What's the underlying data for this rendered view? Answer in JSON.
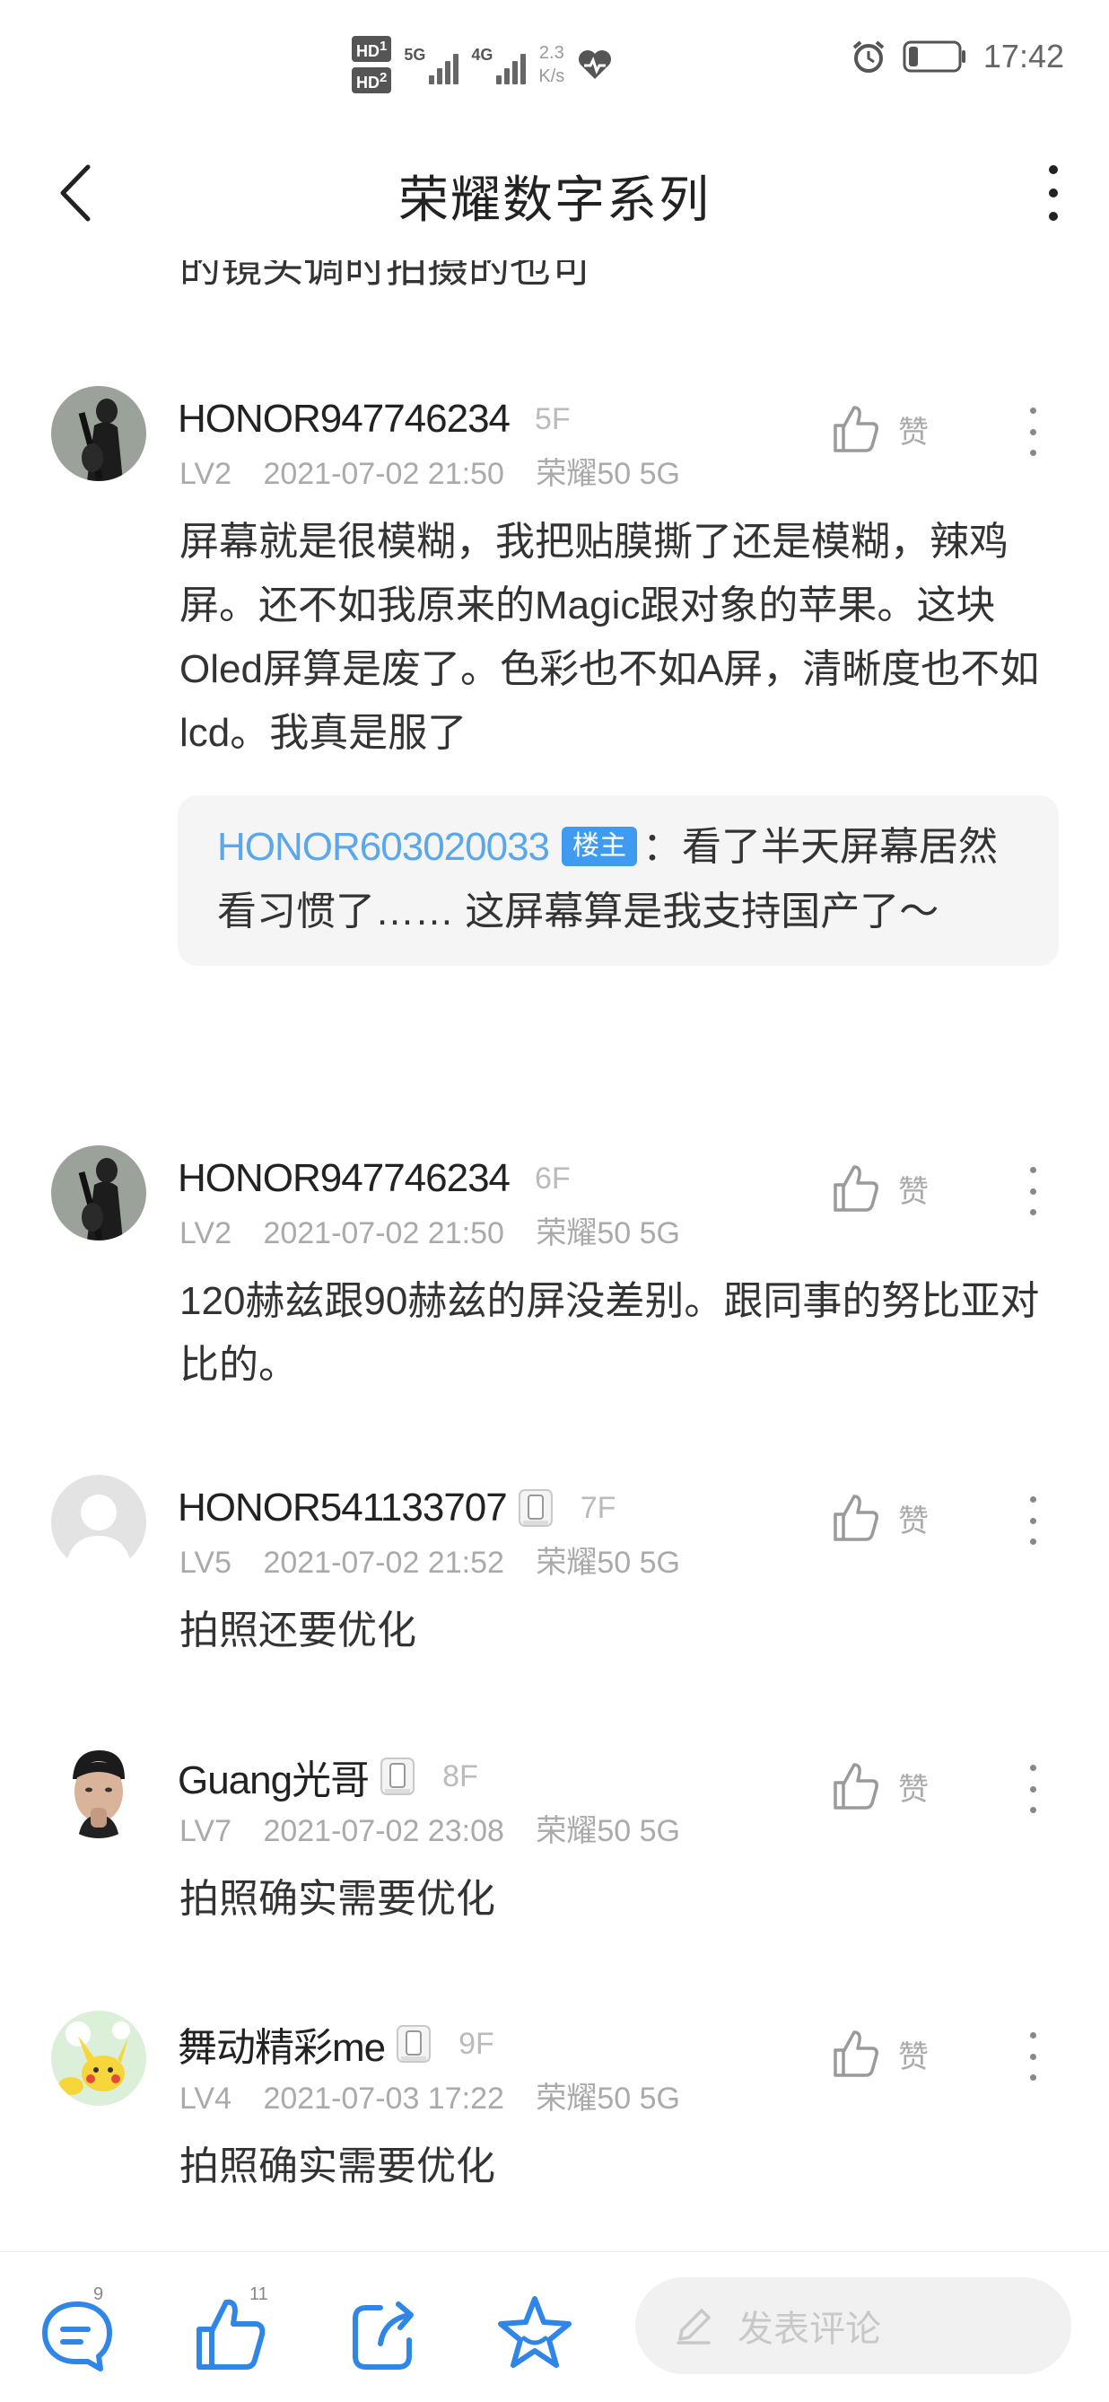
{
  "status_bar": {
    "hd1": "HD",
    "hd1_index": "1",
    "hd2": "HD",
    "hd2_index": "2",
    "net1": "5G",
    "net2": "4G",
    "speed_value": "2.3",
    "speed_unit": "K/s",
    "battery_level": 0.2,
    "time": "17:42"
  },
  "header": {
    "title": "荣耀数字系列"
  },
  "scroll_fragment": "的镜头调时拍摄的也可",
  "comments": [
    {
      "username": "HONOR947746234",
      "floor": "5F",
      "level": "LV2",
      "datetime": "2021-07-02 21:50",
      "device": "荣耀50 5G",
      "like_label": "赞",
      "text": "屏幕就是很模糊，我把贴膜撕了还是模糊，辣鸡屏。还不如我原来的Magic跟对象的苹果。这块Oled屏算是废了。色彩也不如A屏，清晰度也不如lcd。我真是服了",
      "reply": {
        "user": "HONOR603020033",
        "tag": "楼主",
        "text": "：看了半天屏幕居然看习惯了……  这屏幕算是我支持国产了～"
      }
    },
    {
      "username": "HONOR947746234",
      "floor": "6F",
      "level": "LV2",
      "datetime": "2021-07-02 21:50",
      "device": "荣耀50 5G",
      "like_label": "赞",
      "text": "120赫兹跟90赫兹的屏没差别。跟同事的努比亚对比的。"
    },
    {
      "username": "HONOR541133707",
      "floor": "7F",
      "level": "LV5",
      "datetime": "2021-07-02 21:52",
      "device": "荣耀50 5G",
      "like_label": "赞",
      "text": "拍照还要优化"
    },
    {
      "username": "Guang光哥",
      "floor": "8F",
      "level": "LV7",
      "datetime": "2021-07-02 23:08",
      "device": "荣耀50 5G",
      "like_label": "赞",
      "text": "拍照确实需要优化"
    },
    {
      "username": "舞动精彩me",
      "floor": "9F",
      "level": "LV4",
      "datetime": "2021-07-03 17:22",
      "device": "荣耀50 5G",
      "like_label": "赞",
      "text": "拍照确实需要优化"
    }
  ],
  "bottom_bar": {
    "comment_count": "9",
    "like_count": "11",
    "input_placeholder": "发表评论"
  },
  "colors": {
    "link_blue": "#5aa7ea",
    "op_tag_blue": "#3f9bf0",
    "icon_blue": "#2f86e6",
    "reply_bg": "#f5f5f5"
  }
}
